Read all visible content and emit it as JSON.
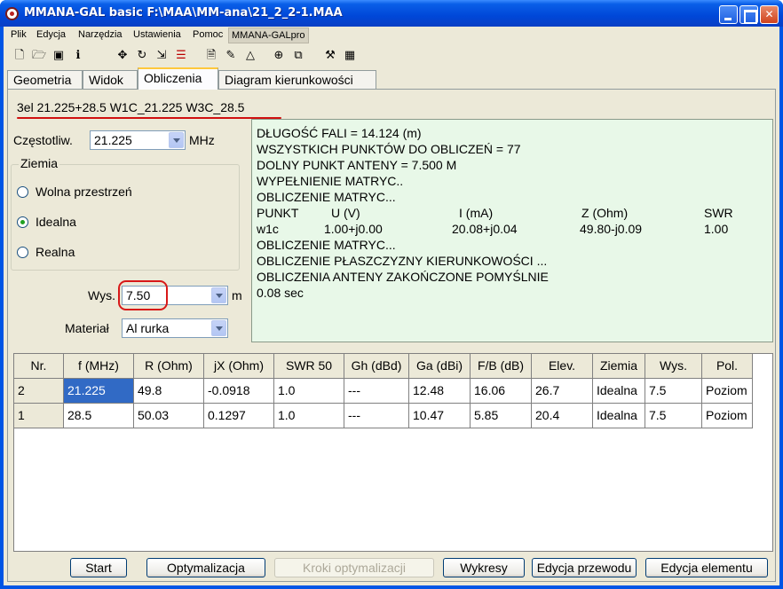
{
  "window": {
    "title": "MMANA-GAL basic F:\\MAA\\MM-ana\\21_2_2-1.MAA",
    "min_label": "",
    "max_label": "",
    "close_label": "✕"
  },
  "menu": [
    "Plik",
    "Edycja",
    "Narzędzia",
    "Ustawienia",
    "Pomoc",
    "MMANA-GALpro"
  ],
  "toolbar_icons": [
    "new-icon",
    "open-icon",
    "save-icon",
    "info-icon",
    "move-icon",
    "rotate-icon",
    "stretch-icon",
    "wire-icon",
    "page-icon",
    "pencil-icon",
    "triangle-icon",
    "target-icon",
    "copy-icon",
    "tools-icon",
    "calculator-icon"
  ],
  "tabs": [
    "Geometria",
    "Widok",
    "Obliczenia",
    "Diagram kierunkowości"
  ],
  "antenna_title": "3el 21.225+28.5 W1C_21.225  W3C_28.5",
  "freq": {
    "label": "Częstotliw.",
    "value": "21.225",
    "unit": "MHz"
  },
  "ground": {
    "legend": "Ziemia",
    "options": [
      {
        "label": "Wolna przestrzeń",
        "checked": false
      },
      {
        "label": "Idealna",
        "checked": true
      },
      {
        "label": "Realna",
        "checked": false
      }
    ]
  },
  "height": {
    "label": "Wys.",
    "value": "7.50",
    "unit": "m"
  },
  "material": {
    "label": "Materiał",
    "value": "Al rurka"
  },
  "output": {
    "lines_before": [
      "DŁUGOŚĆ FALI = 14.124 (m)",
      "WSZYSTKICH PUNKTÓW DO OBLICZEŃ = 77",
      "DOLNY PUNKT ANTENY = 7.500 M",
      "WYPEŁNIENIE MATRYC..",
      "OBLICZENIE MATRYC..."
    ],
    "header": [
      "PUNKT",
      "U (V)",
      "I (mA)",
      "Z (Ohm)",
      "SWR"
    ],
    "row": [
      "w1c",
      "1.00+j0.00",
      "20.08+j0.04",
      "49.80-j0.09",
      "1.00"
    ],
    "lines_after": [
      "OBLICZENIE MATRYC...",
      "OBLICZENIE PŁASZCZYZNY KIERUNKOWOŚCI ...",
      "OBLICZENIA ANTENY ZAKOŃCZONE POMYŚLNIE",
      "0.08 sec"
    ]
  },
  "table": {
    "columns": [
      "Nr.",
      "f (MHz)",
      "R (Ohm)",
      "jX (Ohm)",
      "SWR 50",
      "Gh (dBd)",
      "Ga (dBi)",
      "F/B (dB)",
      "Elev.",
      "Ziemia",
      "Wys.",
      "Pol."
    ],
    "rows": [
      [
        "2",
        "21.225",
        "49.8",
        "-0.0918",
        "1.0",
        "---",
        "12.48",
        "16.06",
        "26.7",
        "Idealna",
        "7.5",
        "Poziom"
      ],
      [
        "1",
        "28.5",
        "50.03",
        "0.1297",
        "1.0",
        "---",
        "10.47",
        "5.85",
        "20.4",
        "Idealna",
        "7.5",
        "Poziom"
      ]
    ]
  },
  "buttons": {
    "start": "Start",
    "optimize": "Optymalizacja",
    "steps": "Kroki optymalizacji",
    "charts": "Wykresy",
    "edit_wire": "Edycja przewodu",
    "edit_element": "Edycja elementu"
  }
}
